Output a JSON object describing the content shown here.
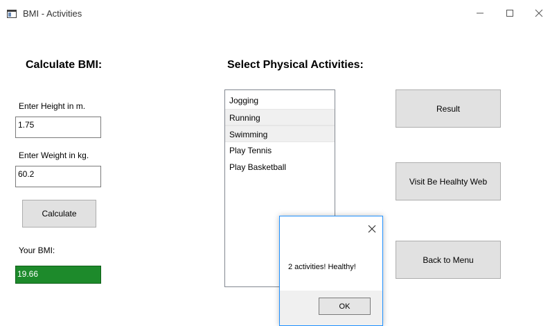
{
  "window": {
    "title": "BMI - Activities",
    "controls": {
      "minimize": "—",
      "maximize": "☐",
      "close": "✕"
    }
  },
  "bmi_panel": {
    "heading": "Calculate BMI:",
    "height_label": "Enter Height in m.",
    "height_value": "1.75",
    "weight_label": "Enter Weight in kg.",
    "weight_value": "60.2",
    "calculate_label": "Calculate",
    "result_label": "Your BMI:",
    "result_value": "19.66"
  },
  "activities_panel": {
    "heading": "Select Physical Activities:",
    "items": [
      {
        "label": "Jogging",
        "selected": false
      },
      {
        "label": "Running",
        "selected": true
      },
      {
        "label": "Swimming",
        "selected": true
      },
      {
        "label": "Play Tennis",
        "selected": false
      },
      {
        "label": "Play Basketball",
        "selected": false
      }
    ]
  },
  "actions": {
    "result_label": "Result",
    "visit_label": "Visit Be Healhty Web",
    "back_label": "Back to Menu"
  },
  "dialog": {
    "message": "2 activities! Healthy!",
    "ok_label": "OK",
    "close_icon": "✕"
  },
  "colors": {
    "bmi_result_bg": "#1d8a2b",
    "dialog_border": "#1e90ff",
    "button_bg": "#e1e1e1"
  }
}
